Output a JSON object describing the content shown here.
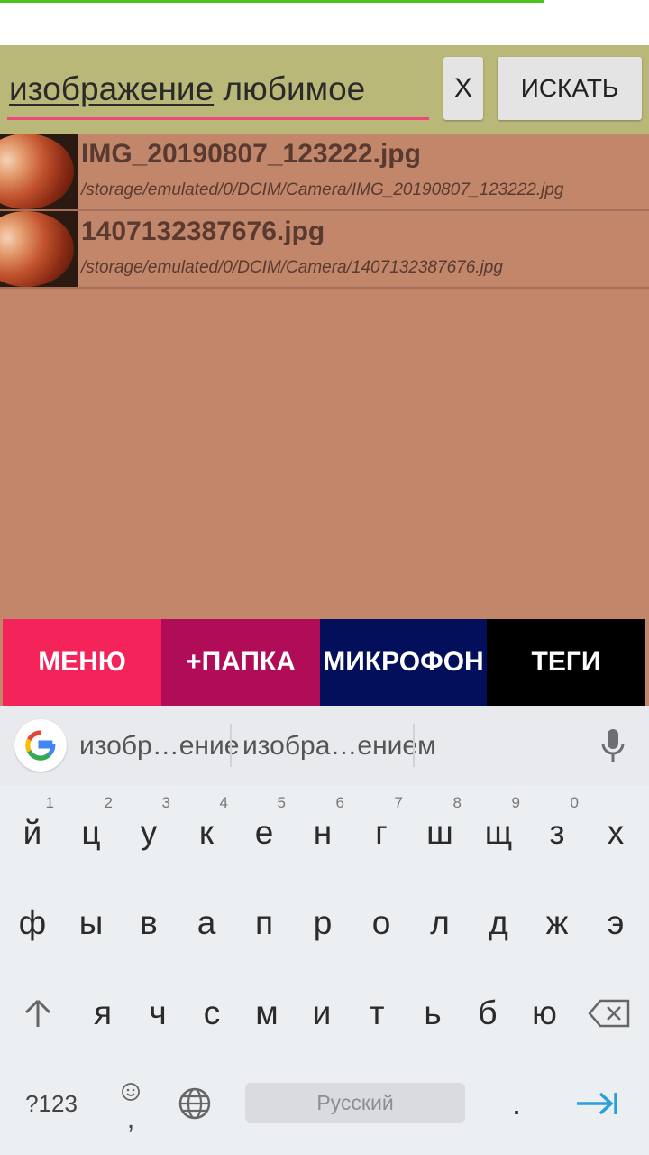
{
  "search": {
    "word1": "изображение",
    "word2": "любимое",
    "clear_label": "X",
    "search_label": "ИСКАТЬ"
  },
  "results": [
    {
      "name": "IMG_20190807_123222.jpg",
      "path": "/storage/emulated/0/DCIM/Camera/IMG_20190807_123222.jpg"
    },
    {
      "name": "1407132387676.jpg",
      "path": "/storage/emulated/0/DCIM/Camera/1407132387676.jpg"
    }
  ],
  "actions": {
    "menu": "МЕНЮ",
    "folder": "+ПАПКА",
    "microphone": "МИКРОФОН",
    "tags": "ТЕГИ"
  },
  "keyboard": {
    "suggestions": [
      "изобр…ение",
      "изобра…ением"
    ],
    "row1": [
      "й",
      "ц",
      "у",
      "к",
      "е",
      "н",
      "г",
      "ш",
      "щ",
      "з",
      "х"
    ],
    "row1_nums": [
      "1",
      "2",
      "3",
      "4",
      "5",
      "6",
      "7",
      "8",
      "9",
      "0",
      ""
    ],
    "row2": [
      "ф",
      "ы",
      "в",
      "а",
      "п",
      "р",
      "о",
      "л",
      "д",
      "ж",
      "э"
    ],
    "row3": [
      "я",
      "ч",
      "с",
      "м",
      "и",
      "т",
      "ь",
      "б",
      "ю"
    ],
    "symbols_label": "?123",
    "comma": ",",
    "space_label": "Русский",
    "period": "."
  }
}
